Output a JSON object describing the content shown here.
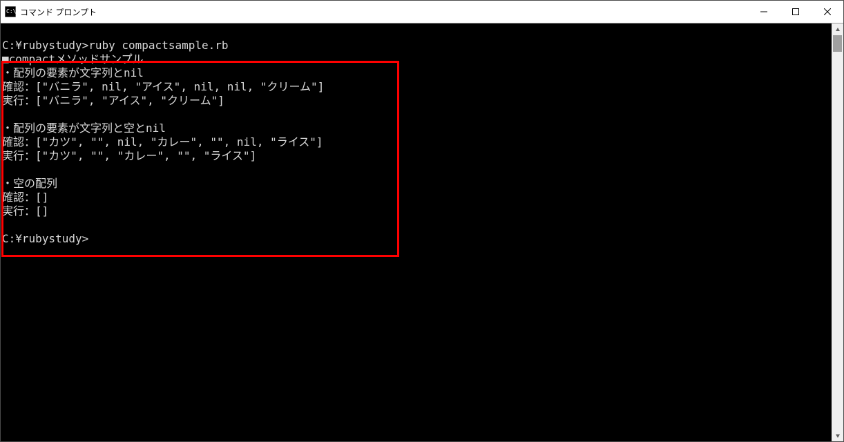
{
  "window": {
    "title": "コマンド プロンプト"
  },
  "terminal": {
    "lines": [
      "",
      "C:¥rubystudy>ruby compactsample.rb",
      "■compactメソッドサンプル",
      "・配列の要素が文字列とnil",
      "確認：[\"バニラ\", nil, \"アイス\", nil, nil, \"クリーム\"]",
      "実行：[\"バニラ\", \"アイス\", \"クリーム\"]",
      "",
      "・配列の要素が文字列と空とnil",
      "確認：[\"カツ\", \"\", nil, \"カレー\", \"\", nil, \"ライス\"]",
      "実行：[\"カツ\", \"\", \"カレー\", \"\", \"ライス\"]",
      "",
      "・空の配列",
      "確認：[]",
      "実行：[]",
      "",
      "C:¥rubystudy>",
      ""
    ]
  },
  "highlight": {
    "present": true
  }
}
